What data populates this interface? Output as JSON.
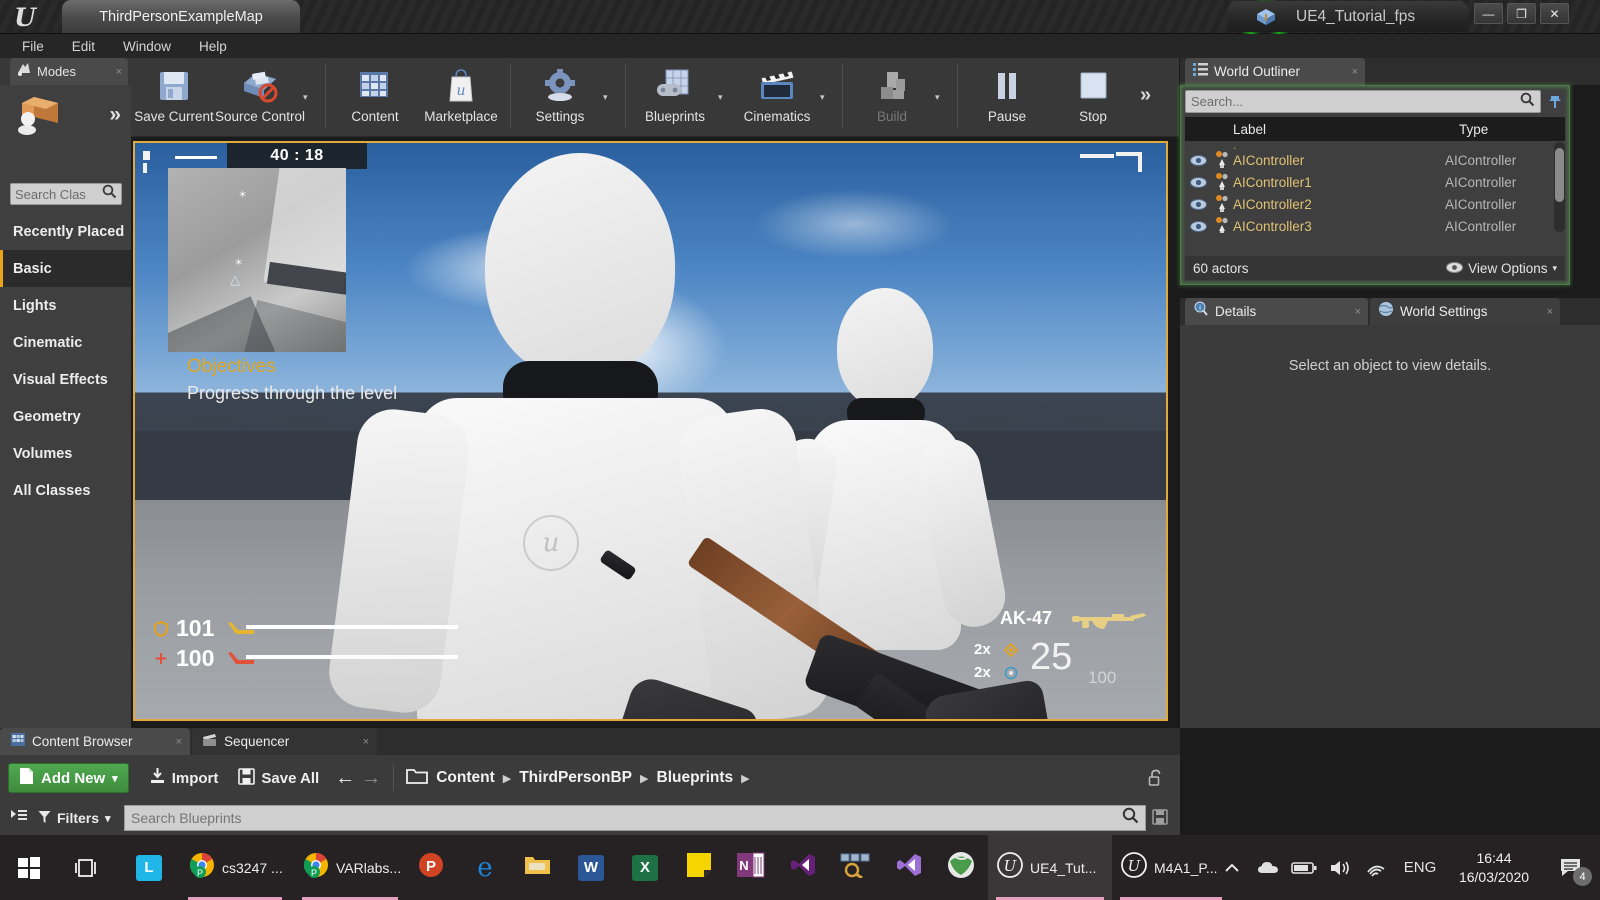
{
  "titlebar": {
    "map_tab": "ThirdPersonExampleMap",
    "project_tab": "UE4_Tutorial_fps",
    "minimize": "—",
    "maximize": "❐",
    "close": "✕"
  },
  "menubar": {
    "items": [
      "File",
      "Edit",
      "Window",
      "Help"
    ]
  },
  "modes": {
    "tab_label": "Modes",
    "close": "×",
    "expand": "»",
    "search_placeholder": "Search Clas",
    "categories": [
      {
        "label": "Recently Placed",
        "selected": false
      },
      {
        "label": "Basic",
        "selected": true
      },
      {
        "label": "Lights",
        "selected": false
      },
      {
        "label": "Cinematic",
        "selected": false
      },
      {
        "label": "Visual Effects",
        "selected": false
      },
      {
        "label": "Geometry",
        "selected": false
      },
      {
        "label": "Volumes",
        "selected": false
      },
      {
        "label": "All Classes",
        "selected": false
      }
    ]
  },
  "toolbar": {
    "buttons": [
      {
        "label": "Save Current",
        "icon": "floppy-disk-icon",
        "caret": false,
        "dim": false
      },
      {
        "label": "Source Control",
        "icon": "source-control-icon",
        "caret": true,
        "dim": false
      },
      {
        "label": "Content",
        "icon": "content-grid-icon",
        "caret": false,
        "dim": false
      },
      {
        "label": "Marketplace",
        "icon": "marketplace-bag-icon",
        "caret": false,
        "dim": false
      },
      {
        "label": "Settings",
        "icon": "gear-icon",
        "caret": true,
        "dim": false
      },
      {
        "label": "Blueprints",
        "icon": "blueprints-icon",
        "caret": true,
        "dim": false
      },
      {
        "label": "Cinematics",
        "icon": "clapperboard-icon",
        "caret": true,
        "dim": false
      },
      {
        "label": "Build",
        "icon": "build-blocks-icon",
        "caret": true,
        "dim": true
      },
      {
        "label": "Pause",
        "icon": "pause-icon",
        "caret": false,
        "dim": false
      },
      {
        "label": "Stop",
        "icon": "stop-icon",
        "caret": false,
        "dim": false
      }
    ],
    "overflow": "»"
  },
  "viewport_hud": {
    "timer": "40 : 18",
    "objectives_title": "Objectives",
    "objectives_sub": "Progress through the level",
    "armor_value": "101",
    "health_value": "100",
    "weapon_name": "AK-47",
    "grenade_mult": "2x",
    "flash_mult": "2x",
    "ammo_clip": "25",
    "ammo_reserve": "100"
  },
  "outliner": {
    "tab_label": "World Outliner",
    "tab_close": "×",
    "search_placeholder": "Search...",
    "columns": [
      "Label",
      "Type"
    ],
    "rows": [
      {
        "label": "AIController",
        "type": "AIController"
      },
      {
        "label": "AIController1",
        "type": "AIController"
      },
      {
        "label": "AIController2",
        "type": "AIController"
      },
      {
        "label": "AIController3",
        "type": "AIController"
      }
    ],
    "footer_count": "60 actors",
    "footer_options": "View Options"
  },
  "details": {
    "tab_details": "Details",
    "tab_world_settings": "World Settings",
    "tab_close": "×",
    "empty_message": "Select an object to view details."
  },
  "content_browser": {
    "tab_content_browser": "Content Browser",
    "tab_sequencer": "Sequencer",
    "tab_close": "×",
    "add_new": "Add New",
    "add_new_caret": "▾",
    "import": "Import",
    "save_all": "Save All",
    "back_arrow": "←",
    "forward_arrow": "→",
    "breadcrumbs": [
      "Content",
      "ThirdPersonBP",
      "Blueprints"
    ],
    "crumb_sep": "▶",
    "filters": "Filters",
    "filters_caret": "▾",
    "search_placeholder": "Search Blueprints",
    "lock_icon": "unlock-icon",
    "save_icon": "save-icon"
  },
  "taskbar": {
    "start": "start-icon",
    "taskview": "task-view-icon",
    "items": [
      {
        "name": "lumion-app",
        "glyph": "L",
        "label": "",
        "color": "#20b6e8",
        "text": "#ffffff",
        "active": false,
        "underline": false
      },
      {
        "name": "chrome-cs3247",
        "glyph": "chrome",
        "label": "cs3247 ...",
        "color": "",
        "text": "",
        "active": false,
        "underline": true
      },
      {
        "name": "chrome-varlabs",
        "glyph": "chrome",
        "label": "VARlabs...",
        "color": "",
        "text": "",
        "active": false,
        "underline": true
      },
      {
        "name": "powerpoint",
        "glyph": "P",
        "label": "",
        "color": "#d04423",
        "text": "#ffffff",
        "active": false,
        "underline": false
      },
      {
        "name": "edge",
        "glyph": "e",
        "label": "",
        "color": "",
        "text": "#1b84d8",
        "active": false,
        "underline": false
      },
      {
        "name": "file-explorer",
        "glyph": "folder",
        "label": "",
        "color": "#f0c04a",
        "text": "",
        "active": false,
        "underline": false
      },
      {
        "name": "word",
        "glyph": "W",
        "label": "",
        "color": "#2b5797",
        "text": "#ffffff",
        "active": false,
        "underline": false
      },
      {
        "name": "excel",
        "glyph": "X",
        "label": "",
        "color": "#1e7145",
        "text": "#ffffff",
        "active": false,
        "underline": false
      },
      {
        "name": "sticky-notes",
        "glyph": "note",
        "label": "",
        "color": "#f5d400",
        "text": "",
        "active": false,
        "underline": false
      },
      {
        "name": "onenote",
        "glyph": "N",
        "label": "",
        "color": "#80397b",
        "text": "#ffffff",
        "active": false,
        "underline": false
      },
      {
        "name": "visual-studio",
        "glyph": "vs",
        "label": "",
        "color": "",
        "text": "#68217a",
        "active": false,
        "underline": false
      },
      {
        "name": "network-tool",
        "glyph": "net",
        "label": "",
        "color": "",
        "text": "",
        "active": false,
        "underline": false
      },
      {
        "name": "vscode",
        "glyph": "vsc",
        "label": "",
        "color": "",
        "text": "#9b6fd4",
        "active": false,
        "underline": false
      },
      {
        "name": "browser-globe",
        "glyph": "globe",
        "label": "",
        "color": "",
        "text": "",
        "active": false,
        "underline": false
      },
      {
        "name": "ue4-editor",
        "glyph": "ue",
        "label": "UE4_Tut...",
        "color": "",
        "text": "",
        "active": true,
        "underline": true
      },
      {
        "name": "ue4-m4a1",
        "glyph": "ue",
        "label": "M4A1_P...",
        "color": "",
        "text": "",
        "active": false,
        "underline": true
      }
    ],
    "tray": {
      "chevron": "︿",
      "cloud": "cloud-icon",
      "battery": "battery-icon",
      "volume": "volume-icon",
      "wifi": "wifi-icon",
      "language": "ENG",
      "time": "16:44",
      "date": "16/03/2020",
      "notification_count": "4"
    }
  },
  "colors": {
    "accent_orange": "#e8a317",
    "outliner_green": "#5abe5a",
    "label_yellow": "#e0c174",
    "addnew_green": "#4fa94f"
  }
}
